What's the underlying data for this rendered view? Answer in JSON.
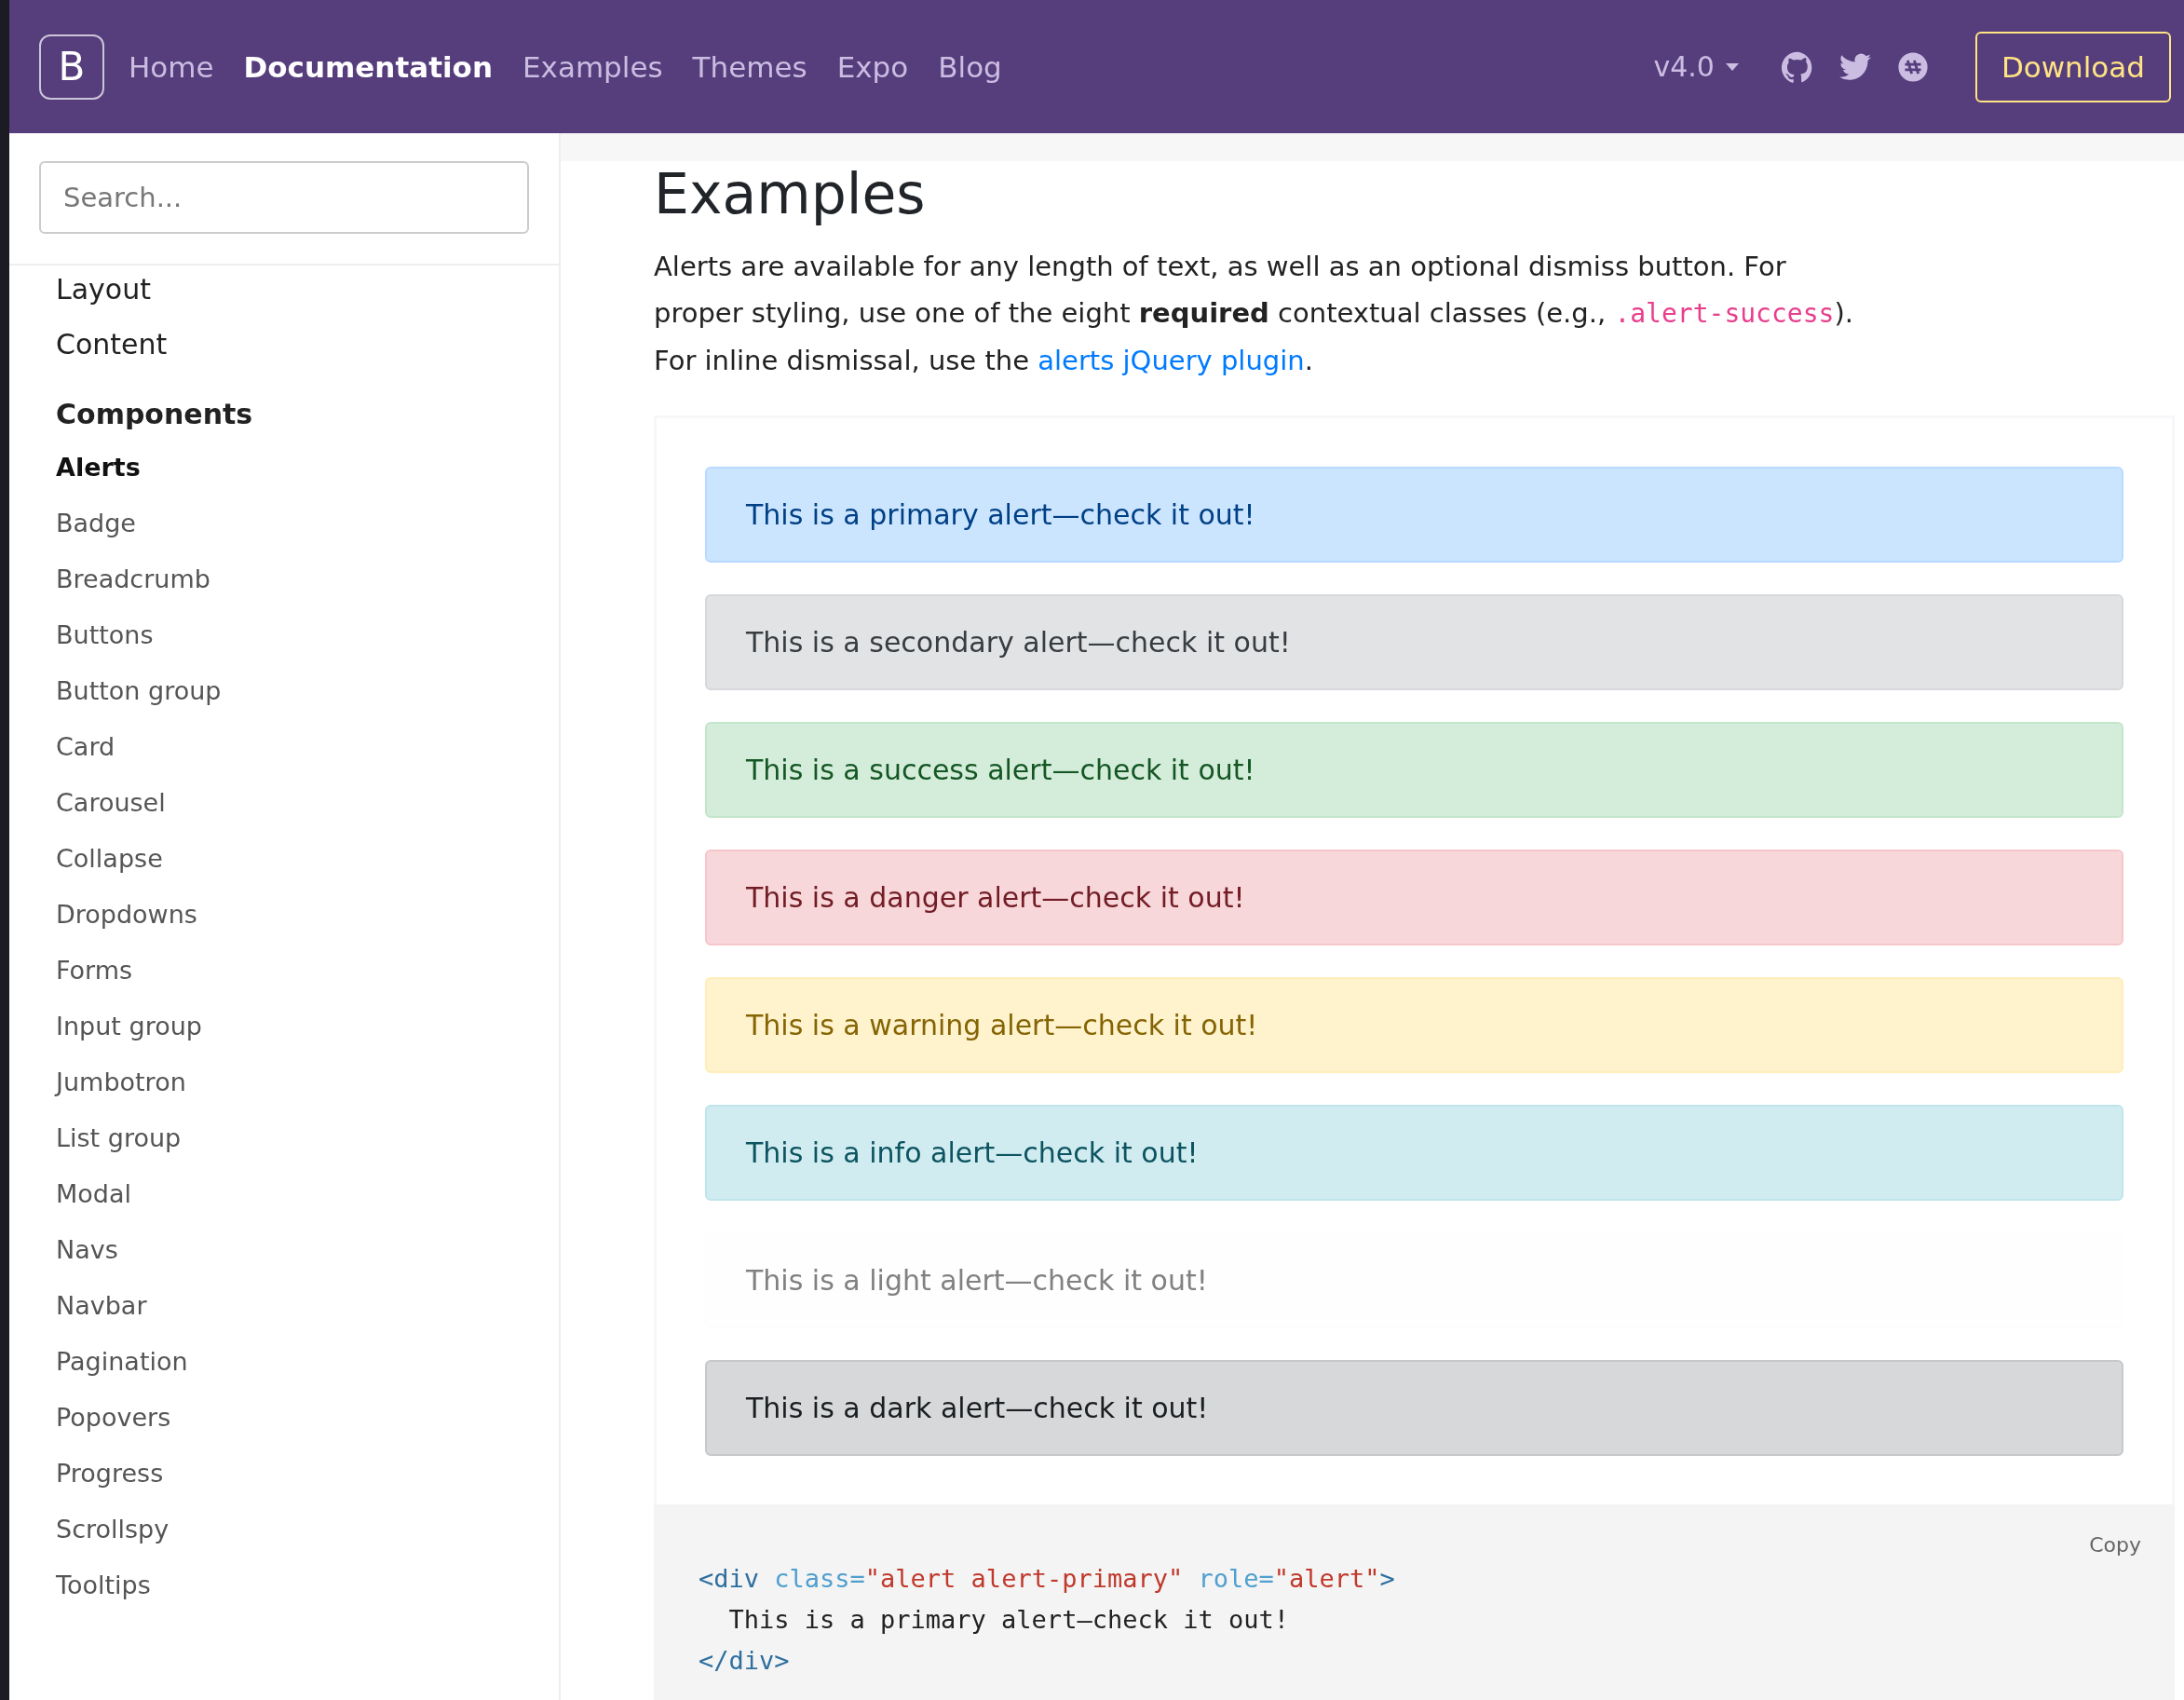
{
  "navbar": {
    "brand": "B",
    "links": [
      {
        "label": "Home",
        "selected": false
      },
      {
        "label": "Documentation",
        "selected": true
      },
      {
        "label": "Examples",
        "selected": false
      },
      {
        "label": "Themes",
        "selected": false
      },
      {
        "label": "Expo",
        "selected": false
      },
      {
        "label": "Blog",
        "selected": false
      }
    ],
    "version": "v4.0",
    "download": "Download"
  },
  "sidebar": {
    "search": {
      "placeholder": "Search..."
    },
    "sections": [
      {
        "kind": "link",
        "title": "Layout"
      },
      {
        "kind": "link",
        "title": "Content"
      },
      {
        "kind": "group",
        "title": "Components",
        "items": [
          {
            "label": "Alerts",
            "selected": true
          },
          {
            "label": "Badge",
            "selected": false
          },
          {
            "label": "Breadcrumb",
            "selected": false
          },
          {
            "label": "Buttons",
            "selected": false
          },
          {
            "label": "Button group",
            "selected": false
          },
          {
            "label": "Card",
            "selected": false
          },
          {
            "label": "Carousel",
            "selected": false
          },
          {
            "label": "Collapse",
            "selected": false
          },
          {
            "label": "Dropdowns",
            "selected": false
          },
          {
            "label": "Forms",
            "selected": false
          },
          {
            "label": "Input group",
            "selected": false
          },
          {
            "label": "Jumbotron",
            "selected": false
          },
          {
            "label": "List group",
            "selected": false
          },
          {
            "label": "Modal",
            "selected": false
          },
          {
            "label": "Navs",
            "selected": false
          },
          {
            "label": "Navbar",
            "selected": false
          },
          {
            "label": "Pagination",
            "selected": false
          },
          {
            "label": "Popovers",
            "selected": false
          },
          {
            "label": "Progress",
            "selected": false
          },
          {
            "label": "Scrollspy",
            "selected": false
          },
          {
            "label": "Tooltips",
            "selected": false
          }
        ]
      }
    ]
  },
  "content": {
    "title": "Examples",
    "intro": [
      {
        "kind": "text",
        "text": "Alerts are available for any length of text, as well as an optional dismiss button. For proper styling, use one of the eight **required** contextual classes (e.g., "
      },
      {
        "kind": "code",
        "text": ".alert-success"
      },
      {
        "kind": "text",
        "text": "). For inline dismissal, use the "
      },
      {
        "kind": "link",
        "text": "alerts jQuery plugin"
      },
      {
        "kind": "text",
        "text": "."
      }
    ],
    "alerts": [
      {
        "color": "#cce5ff",
        "text": "This is a primary alert—check it out!"
      },
      {
        "color": "#e2e3e5",
        "text": "This is a secondary alert—check it out!"
      },
      {
        "color": "#d4edda",
        "text": "This is a success alert—check it out!"
      },
      {
        "color": "#f8d7da",
        "text": "This is a danger alert—check it out!"
      },
      {
        "color": "#fff3cd",
        "text": "This is a warning alert—check it out!"
      },
      {
        "color": "#d1ecf1",
        "text": "This is a info alert—check it out!"
      },
      {
        "color": "#fefefe",
        "text": "This is a light alert—check it out!"
      },
      {
        "color": "#d6d8d9",
        "text": "This is a dark alert—check it out!"
      }
    ],
    "code": {
      "copy": "Copy",
      "lines": [
        [
          {
            "kind": "tag",
            "text": "<div "
          },
          {
            "kind": "attr",
            "text": "class="
          },
          {
            "kind": "string",
            "text": "\"alert alert-primary\""
          },
          {
            "kind": "attr",
            "text": " role="
          },
          {
            "kind": "string",
            "text": "\"alert\""
          },
          {
            "kind": "tag",
            "text": ">"
          }
        ],
        [
          {
            "kind": "text",
            "text": "  This is a primary alert—check it out!"
          }
        ],
        [
          {
            "kind": "tag",
            "text": "</div>"
          }
        ]
      ]
    }
  }
}
